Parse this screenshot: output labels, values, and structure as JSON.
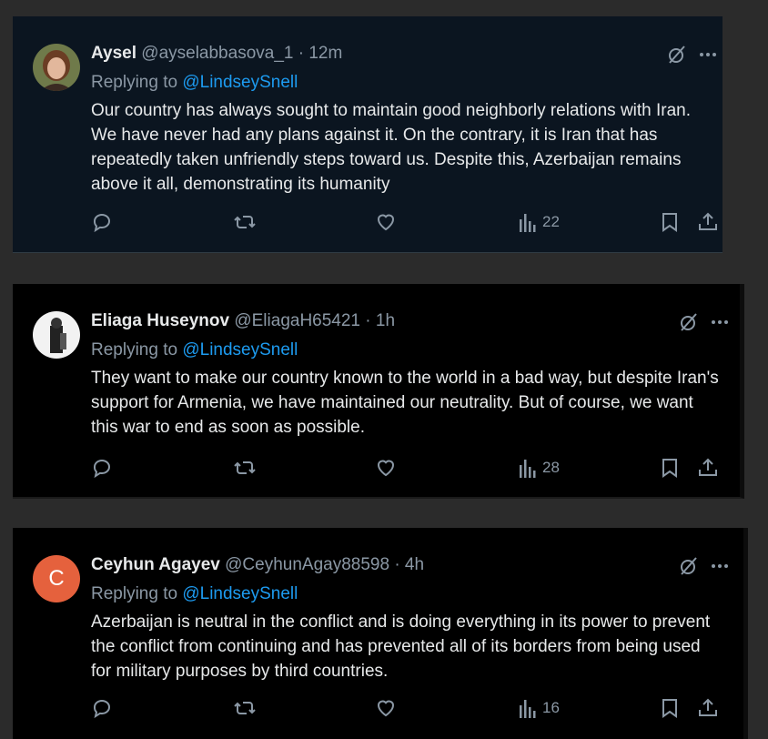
{
  "replies": [
    {
      "name": "Aysel",
      "handle": "@ayselabbasova_1",
      "time": "· 12m",
      "replying_prefix": "Replying to",
      "mention": "@LindseySnell",
      "text": "Our country has always sought to maintain good neighborly relations with Iran. We have never had any plans against it. On the contrary, it is Iran that has repeatedly taken unfriendly steps toward us. Despite this, Azerbaijan remains above it all, demonstrating its humanity",
      "views": "22"
    },
    {
      "name": "Eliaga Huseynov",
      "handle": "@EliagaH65421",
      "time": "· 1h",
      "replying_prefix": "Replying to",
      "mention": "@LindseySnell",
      "text": "They want to make our country known to the world in a bad way, but despite Iran's support for Armenia, we have maintained our neutrality. But of course, we want this war to end as soon as possible.",
      "views": "28"
    },
    {
      "name": "Ceyhun Agayev",
      "handle": "@CeyhunAgay88598",
      "time": "· 4h",
      "replying_prefix": "Replying to",
      "mention": "@LindseySnell",
      "avatar_letter": "C",
      "text": "Azerbaijan is neutral in the conflict and is doing everything in its power to prevent the conflict from continuing and has prevented all of its borders from being used for military purposes by third countries.",
      "views": "16"
    }
  ],
  "colors": {
    "accent": "#1d9bf0",
    "muted": "#8b98a5",
    "avatar_c": "#e5613d"
  },
  "icons": [
    "grok-icon",
    "more-icon",
    "reply-icon",
    "retweet-icon",
    "like-icon",
    "views-icon",
    "bookmark-icon",
    "share-icon"
  ]
}
